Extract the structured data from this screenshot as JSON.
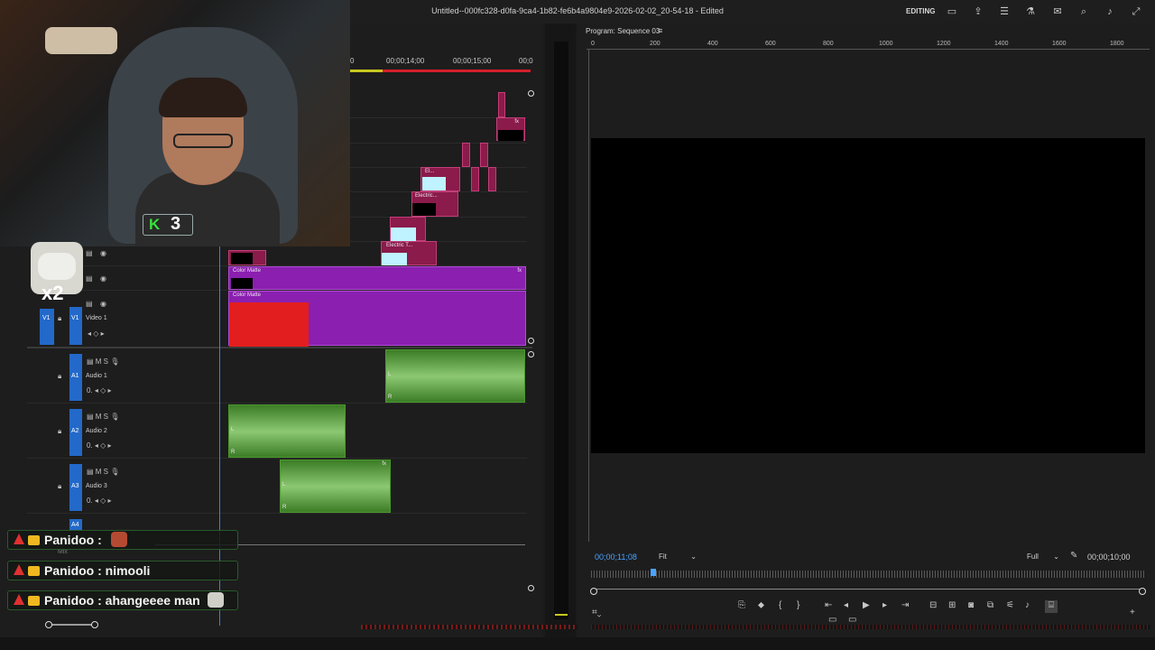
{
  "app": {
    "doc_title": "Untitled--000fc328-d0fa-9ca4-1b82-fe6b4a9804e9-2026-02-02_20-54-18 - Edited",
    "mode": "EDITING"
  },
  "timeline": {
    "ruler": [
      "0",
      "00;00;14;00",
      "00;00;15;00",
      "00;0"
    ],
    "tracks_video": [
      {
        "name": "Video 1",
        "code": "V1",
        "src": "V1"
      }
    ],
    "tracks_audio": [
      {
        "name": "Audio 1",
        "code": "A1"
      },
      {
        "name": "Audio 2",
        "code": "A2"
      },
      {
        "name": "Audio 3",
        "code": "A3"
      },
      {
        "name": "A4",
        "code": "A4"
      }
    ],
    "clips": {
      "color_matte_1": "Color Matte",
      "color_matte_2": "Color Matte",
      "electric_1": "Electric T...",
      "electric_2": "Electric...",
      "el": "El...",
      "fx": "fx",
      "mix_label": "Mix"
    },
    "audio_channel_l": "L",
    "audio_channel_r": "R"
  },
  "webcam": {
    "badge_letter": "K",
    "badge_number": "3",
    "multiplier": "x2"
  },
  "chat": [
    {
      "user": "Panidoo",
      "text": "Panidoo :"
    },
    {
      "user": "Panidoo",
      "text": "Panidoo : nimooli"
    },
    {
      "user": "Panidoo",
      "text": "Panidoo : ahangeeee man"
    }
  ],
  "program_monitor": {
    "title": "Program: Sequence 03",
    "ruler_ticks": [
      "0",
      "200",
      "400",
      "600",
      "800",
      "1000",
      "1200",
      "1400",
      "1600",
      "1800"
    ],
    "timecode_current": "00;00;11;08",
    "timecode_duration": "00;00;10;00",
    "zoom": "Fit",
    "resolution": "Full"
  },
  "colors": {
    "accent_blue": "#2369c9",
    "playhead_red": "#d41f2a",
    "timecode_blue": "#4aa3ff",
    "clip_purple": "#8a1fb0",
    "clip_red": "#e31e1e",
    "audio_green": "#2f6b1e"
  }
}
